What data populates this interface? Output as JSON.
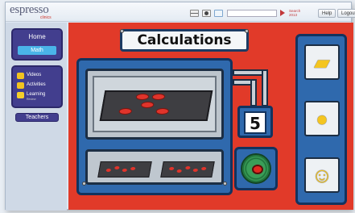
{
  "header": {
    "logo": "espresso",
    "logo_sub": "clinics",
    "search_placeholder": "",
    "search_label": "Search 2013",
    "help": "Help",
    "logout": "Logout"
  },
  "sidebar": {
    "home": "Home",
    "math": "Math",
    "resources": [
      {
        "label": "Videos",
        "icon": "video-icon"
      },
      {
        "label": "Activities",
        "icon": "activities-icon"
      },
      {
        "label": "Learning",
        "sub": "Review",
        "icon": "learning-icon"
      }
    ],
    "teachers": "Teachers"
  },
  "stage": {
    "title": "Calculations",
    "answer": "5",
    "colors": {
      "background": "#e13a29",
      "machine": "#2f69ad",
      "counter": "#e0342b"
    }
  }
}
